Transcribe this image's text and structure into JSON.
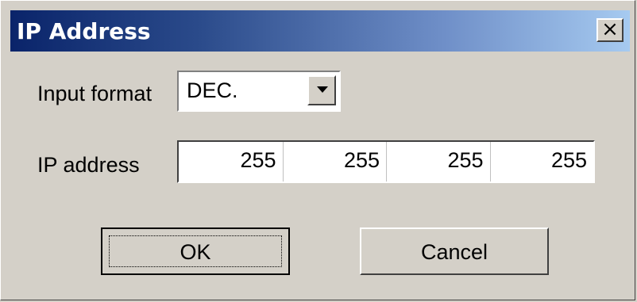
{
  "window": {
    "title": "IP Address",
    "close_label": "×"
  },
  "form": {
    "input_format_label": "Input format",
    "input_format_value": "DEC.",
    "ip_address_label": "IP address",
    "octets": [
      "255",
      "255",
      "255",
      "255"
    ]
  },
  "buttons": {
    "ok_label": "OK",
    "cancel_label": "Cancel"
  },
  "icons": {
    "dropdown": "chevron-down-icon",
    "close": "close-icon"
  }
}
